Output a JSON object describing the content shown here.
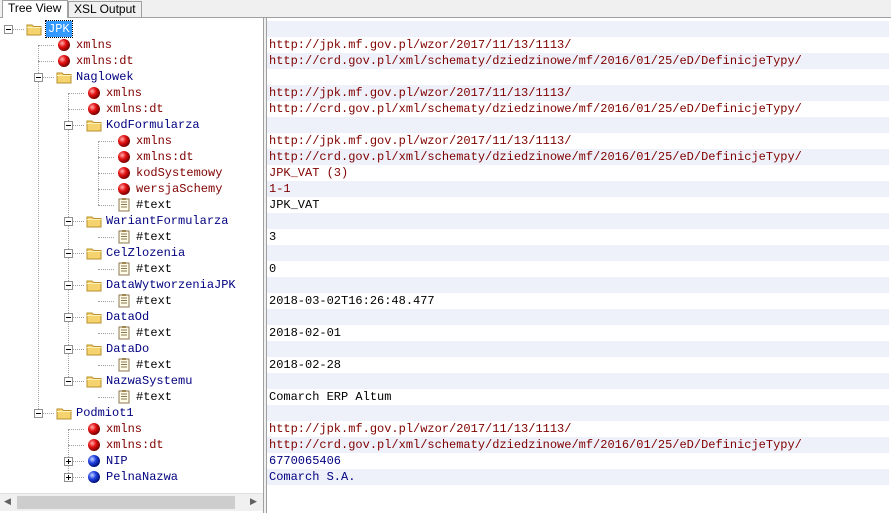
{
  "tabs": [
    "Tree View",
    "XSL Output"
  ],
  "active_tab": 0,
  "rows": [
    {
      "level": 0,
      "type": "element",
      "name": "JPK",
      "value": "",
      "expander": "minus",
      "selected": true
    },
    {
      "level": 1,
      "type": "attribute",
      "name": "xmlns",
      "value": "http://jpk.mf.gov.pl/wzor/2017/11/13/1113/"
    },
    {
      "level": 1,
      "type": "attribute",
      "name": "xmlns:dt",
      "value": "http://crd.gov.pl/xml/schematy/dziedzinowe/mf/2016/01/25/eD/DefinicjeTypy/"
    },
    {
      "level": 1,
      "type": "element",
      "name": "Naglowek",
      "value": "",
      "expander": "minus"
    },
    {
      "level": 2,
      "type": "attribute",
      "name": "xmlns",
      "value": "http://jpk.mf.gov.pl/wzor/2017/11/13/1113/"
    },
    {
      "level": 2,
      "type": "attribute",
      "name": "xmlns:dt",
      "value": "http://crd.gov.pl/xml/schematy/dziedzinowe/mf/2016/01/25/eD/DefinicjeTypy/"
    },
    {
      "level": 2,
      "type": "element",
      "name": "KodFormularza",
      "value": "",
      "expander": "minus"
    },
    {
      "level": 3,
      "type": "attribute",
      "name": "xmlns",
      "value": "http://jpk.mf.gov.pl/wzor/2017/11/13/1113/"
    },
    {
      "level": 3,
      "type": "attribute",
      "name": "xmlns:dt",
      "value": "http://crd.gov.pl/xml/schematy/dziedzinowe/mf/2016/01/25/eD/DefinicjeTypy/"
    },
    {
      "level": 3,
      "type": "attribute",
      "name": "kodSystemowy",
      "value": "JPK_VAT (3)"
    },
    {
      "level": 3,
      "type": "attribute",
      "name": "wersjaSchemy",
      "value": "1-1"
    },
    {
      "level": 3,
      "type": "text",
      "name": "#text",
      "value": "JPK_VAT"
    },
    {
      "level": 2,
      "type": "element",
      "name": "WariantFormularza",
      "value": "",
      "expander": "minus"
    },
    {
      "level": 3,
      "type": "text",
      "name": "#text",
      "value": "3"
    },
    {
      "level": 2,
      "type": "element",
      "name": "CelZlozenia",
      "value": "",
      "expander": "minus"
    },
    {
      "level": 3,
      "type": "text",
      "name": "#text",
      "value": "0"
    },
    {
      "level": 2,
      "type": "element",
      "name": "DataWytworzeniaJPK",
      "value": "",
      "expander": "minus"
    },
    {
      "level": 3,
      "type": "text",
      "name": "#text",
      "value": "2018-03-02T16:26:48.477"
    },
    {
      "level": 2,
      "type": "element",
      "name": "DataOd",
      "value": "",
      "expander": "minus"
    },
    {
      "level": 3,
      "type": "text",
      "name": "#text",
      "value": "2018-02-01"
    },
    {
      "level": 2,
      "type": "element",
      "name": "DataDo",
      "value": "",
      "expander": "minus"
    },
    {
      "level": 3,
      "type": "text",
      "name": "#text",
      "value": "2018-02-28"
    },
    {
      "level": 2,
      "type": "element",
      "name": "NazwaSystemu",
      "value": "",
      "expander": "minus"
    },
    {
      "level": 3,
      "type": "text",
      "name": "#text",
      "value": "Comarch ERP Altum"
    },
    {
      "level": 1,
      "type": "element",
      "name": "Podmiot1",
      "value": "",
      "expander": "minus"
    },
    {
      "level": 2,
      "type": "attribute",
      "name": "xmlns",
      "value": "http://jpk.mf.gov.pl/wzor/2017/11/13/1113/"
    },
    {
      "level": 2,
      "type": "attribute",
      "name": "xmlns:dt",
      "value": "http://crd.gov.pl/xml/schematy/dziedzinowe/mf/2016/01/25/eD/DefinicjeTypy/"
    },
    {
      "level": 2,
      "type": "leaf-element",
      "name": "NIP",
      "value": "6770065406",
      "expander": "plus"
    },
    {
      "level": 2,
      "type": "leaf-element",
      "name": "PelnaNazwa",
      "value": "Comarch S.A.",
      "expander": "plus"
    }
  ],
  "icons": {
    "element": "folder-icon",
    "attribute": "red-ball-icon",
    "text": "text-node-icon",
    "leaf-element": "blue-ball-icon"
  },
  "colors": {
    "selection": "#3399ff",
    "element_text": "#000080",
    "attribute_text": "#800000",
    "alt_row": "#eef1fa"
  }
}
